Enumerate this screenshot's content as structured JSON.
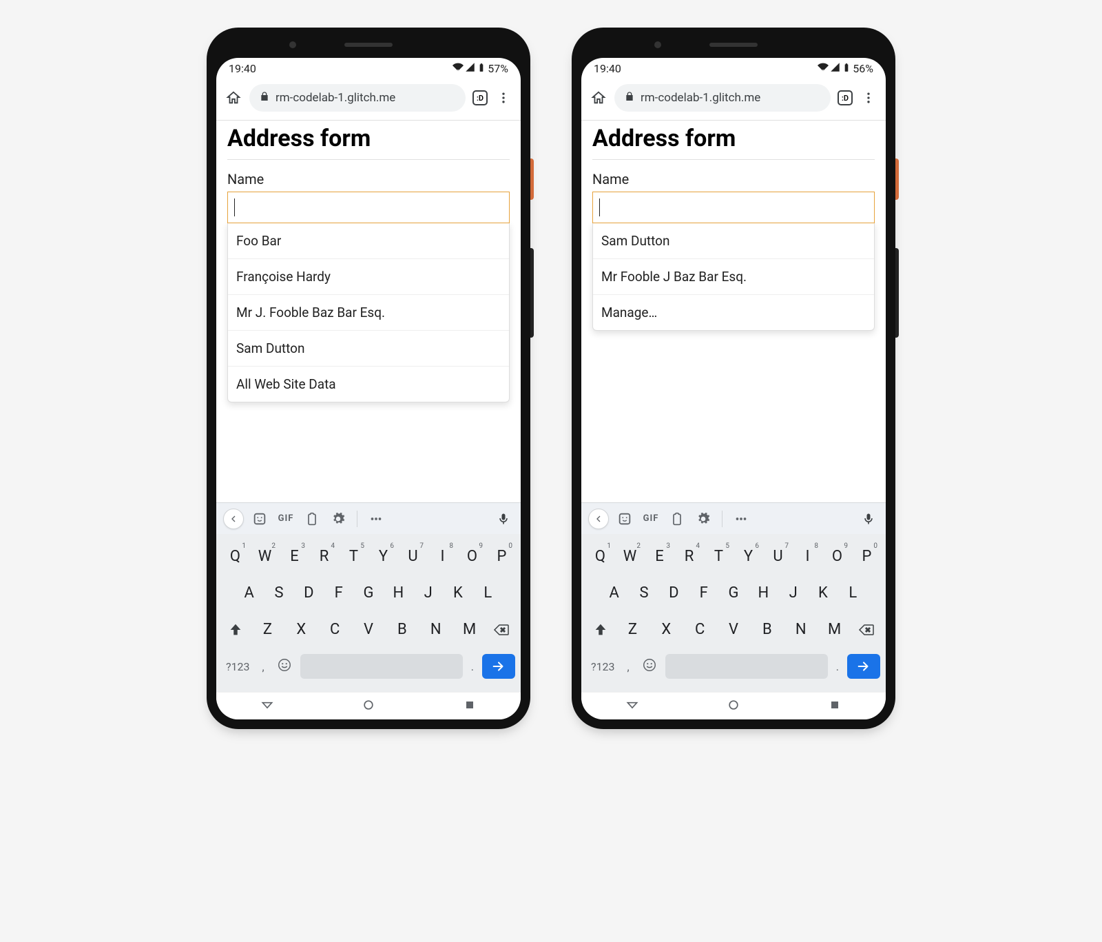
{
  "phones": [
    {
      "status": {
        "time": "19:40",
        "battery": "57%"
      },
      "browser": {
        "url": "rm-codelab-1.glitch.me",
        "tab": ":D"
      },
      "page": {
        "title": "Address form",
        "name_label": "Name",
        "name_value": "",
        "suggestions": [
          "Foo Bar",
          "Françoise Hardy",
          "Mr J. Fooble Baz Bar Esq.",
          "Sam Dutton",
          "All Web Site Data"
        ]
      },
      "keyboard": {
        "gif": "GIF",
        "sym": "?123",
        "row1": [
          {
            "k": "Q",
            "n": "1"
          },
          {
            "k": "W",
            "n": "2"
          },
          {
            "k": "E",
            "n": "3"
          },
          {
            "k": "R",
            "n": "4"
          },
          {
            "k": "T",
            "n": "5"
          },
          {
            "k": "Y",
            "n": "6"
          },
          {
            "k": "U",
            "n": "7"
          },
          {
            "k": "I",
            "n": "8"
          },
          {
            "k": "O",
            "n": "9"
          },
          {
            "k": "P",
            "n": "0"
          }
        ],
        "row2": [
          "A",
          "S",
          "D",
          "F",
          "G",
          "H",
          "J",
          "K",
          "L"
        ],
        "row3": [
          "Z",
          "X",
          "C",
          "V",
          "B",
          "N",
          "M"
        ]
      }
    },
    {
      "status": {
        "time": "19:40",
        "battery": "56%"
      },
      "browser": {
        "url": "rm-codelab-1.glitch.me",
        "tab": ":D"
      },
      "page": {
        "title": "Address form",
        "name_label": "Name",
        "name_value": "",
        "suggestions": [
          "Sam Dutton",
          "Mr Fooble J Baz Bar Esq.",
          "Manage…"
        ]
      },
      "keyboard": {
        "gif": "GIF",
        "sym": "?123",
        "row1": [
          {
            "k": "Q",
            "n": "1"
          },
          {
            "k": "W",
            "n": "2"
          },
          {
            "k": "E",
            "n": "3"
          },
          {
            "k": "R",
            "n": "4"
          },
          {
            "k": "T",
            "n": "5"
          },
          {
            "k": "Y",
            "n": "6"
          },
          {
            "k": "U",
            "n": "7"
          },
          {
            "k": "I",
            "n": "8"
          },
          {
            "k": "O",
            "n": "9"
          },
          {
            "k": "P",
            "n": "0"
          }
        ],
        "row2": [
          "A",
          "S",
          "D",
          "F",
          "G",
          "H",
          "J",
          "K",
          "L"
        ],
        "row3": [
          "Z",
          "X",
          "C",
          "V",
          "B",
          "N",
          "M"
        ]
      }
    }
  ]
}
